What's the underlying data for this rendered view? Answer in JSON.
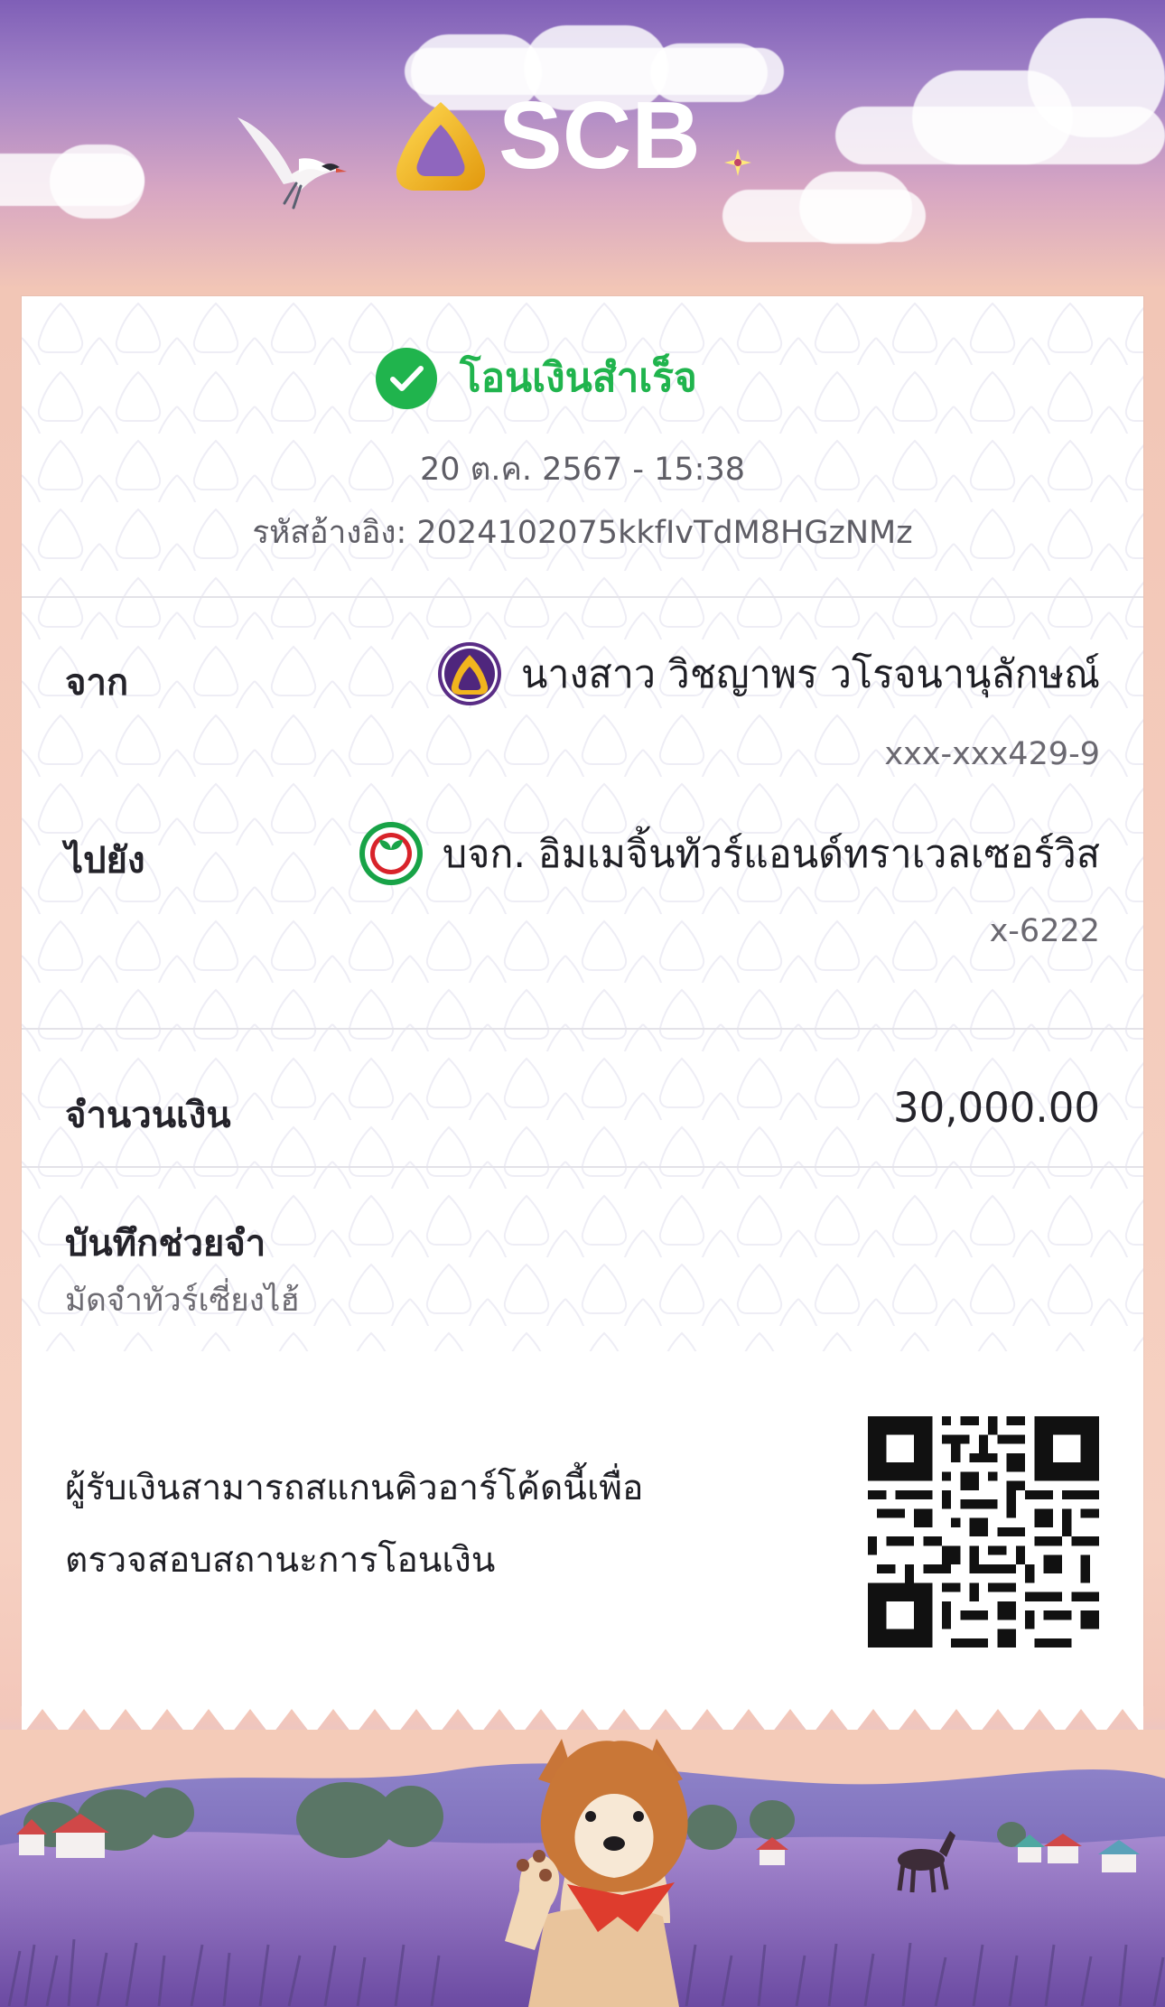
{
  "brand": {
    "name": "SCB",
    "accent": "#6a3b96",
    "logo_gold": "#f0b51d"
  },
  "status": {
    "title": "โอนเงินสำเร็จ",
    "date_time": "20 ต.ค. 2567 - 15:38",
    "reference": "รหัสอ้างอิง: 2024102075kkfIvTdM8HGzNMz",
    "success_color": "#20b44d"
  },
  "transfer": {
    "from_label": "จาก",
    "from_name": "นางสาว วิชญาพร วโรจนานุลักษณ์",
    "from_account": "xxx-xxx429-9",
    "to_label": "ไปยัง",
    "to_name": "บจก. อิมเมจิ้นทัวร์แอนด์ทราเวลเซอร์วิส",
    "to_account": "x-6222"
  },
  "amount": {
    "label": "จำนวนเงิน",
    "value": "30,000.00"
  },
  "memo": {
    "label": "บันทึกช่วยจำ",
    "value": "มัดจำทัวร์เซี่ยงไฮ้"
  },
  "qr": {
    "line1": "ผู้รับเงินสามารถสแกนคิวอาร์โค้ดนี้เพื่อ",
    "line2": "ตรวจสอบสถานะการโอนเงิน"
  },
  "icons": {
    "scb_logo": "scb-logo-icon",
    "kbank_logo": "kbank-logo-icon",
    "success": "success-check-icon",
    "bird": "bird-icon",
    "sparkle": "sparkle-icon"
  }
}
